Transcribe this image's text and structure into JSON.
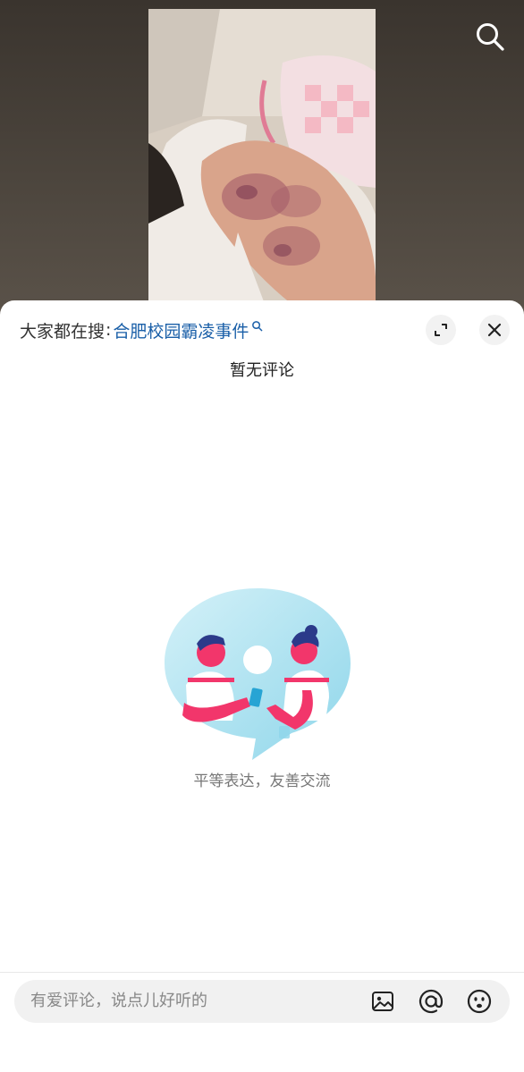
{
  "hot_search": {
    "prefix": "大家都在搜",
    "colon": ":",
    "term": "合肥校园霸凌事件"
  },
  "comments": {
    "empty_title": "暂无评论",
    "empty_caption": "平等表达，友善交流"
  },
  "composer": {
    "placeholder": "有爱评论，说点儿好听的"
  },
  "icons": {
    "search": "search-icon",
    "expand": "expand-icon",
    "close": "close-icon",
    "image": "image-icon",
    "mention": "at-icon",
    "emoji": "emoji-icon"
  },
  "colors": {
    "hot_term": "#1a5fa8",
    "sheet_bg": "#ffffff",
    "input_bg": "#f1f1f1"
  }
}
